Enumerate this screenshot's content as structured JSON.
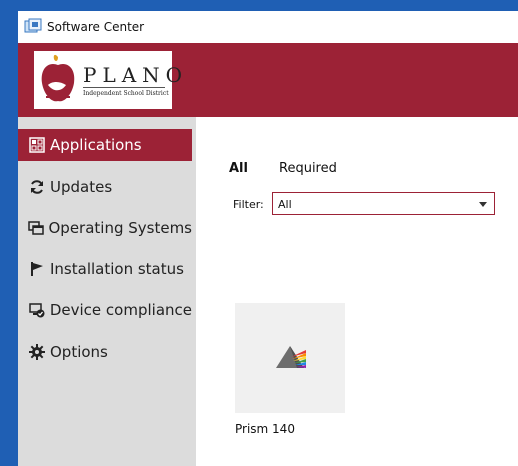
{
  "window": {
    "title": "Software Center"
  },
  "banner": {
    "logo_word": "PLANO",
    "logo_subtitle": "Independent School District"
  },
  "sidebar": {
    "items": [
      {
        "label": "Applications",
        "icon": "applications-icon",
        "active": true
      },
      {
        "label": "Updates",
        "icon": "refresh-icon",
        "active": false
      },
      {
        "label": "Operating Systems",
        "icon": "windows-stack-icon",
        "active": false
      },
      {
        "label": "Installation status",
        "icon": "flag-icon",
        "active": false
      },
      {
        "label": "Device compliance",
        "icon": "device-check-icon",
        "active": false
      },
      {
        "label": "Options",
        "icon": "gear-icon",
        "active": false
      }
    ]
  },
  "main": {
    "tabs": [
      {
        "label": "All",
        "active": true
      },
      {
        "label": "Required",
        "active": false
      }
    ],
    "filter": {
      "label": "Filter:",
      "value": "All"
    },
    "apps": [
      {
        "name": "Prism 140",
        "icon": "prism-icon"
      }
    ]
  },
  "colors": {
    "accent": "#9c2236",
    "sidebar_bg": "#dcdcdc",
    "desktop": "#1f5fb4"
  }
}
